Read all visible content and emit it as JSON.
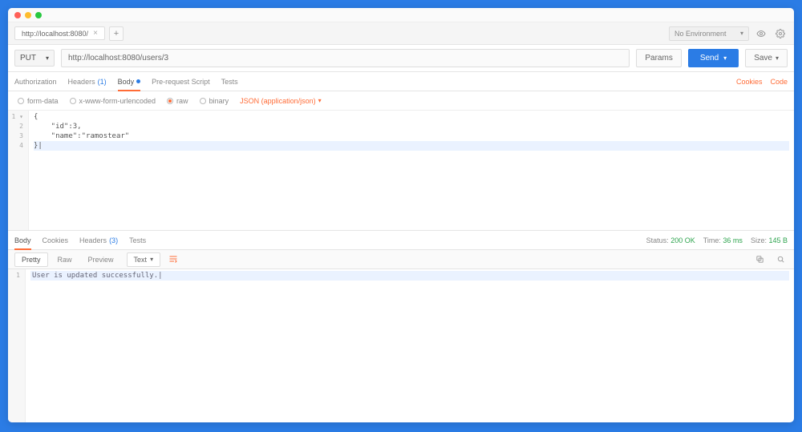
{
  "window": {
    "tab_title": "http://localhost:8080/"
  },
  "environment": {
    "selected": "No Environment"
  },
  "request": {
    "method": "PUT",
    "url": "http://localhost:8080/users/3",
    "buttons": {
      "params": "Params",
      "send": "Send",
      "save": "Save"
    }
  },
  "request_tabs": {
    "authorization": "Authorization",
    "headers_label": "Headers",
    "headers_count": "(1)",
    "body": "Body",
    "prerequest": "Pre-request Script",
    "tests": "Tests",
    "cookies": "Cookies",
    "code": "Code"
  },
  "body_type": {
    "formdata": "form-data",
    "xwww": "x-www-form-urlencoded",
    "raw": "raw",
    "binary": "binary",
    "json_select": "JSON (application/json)"
  },
  "editor": {
    "gutter": [
      "1 ▾",
      "2",
      "3",
      "4"
    ],
    "lines": [
      "{",
      "    \"id\":3,",
      "    \"name\":\"ramostear\"",
      "}|"
    ]
  },
  "response_tabs": {
    "body": "Body",
    "cookies": "Cookies",
    "headers_label": "Headers",
    "headers_count": "(3)",
    "tests": "Tests"
  },
  "response_status": {
    "status_label": "Status:",
    "status_value": "200 OK",
    "time_label": "Time:",
    "time_value": "36 ms",
    "size_label": "Size:",
    "size_value": "145 B"
  },
  "response_view": {
    "pretty": "Pretty",
    "raw": "Raw",
    "preview": "Preview",
    "format": "Text"
  },
  "response_body": {
    "gutter": [
      "1"
    ],
    "line": "User is updated successfully.|"
  }
}
